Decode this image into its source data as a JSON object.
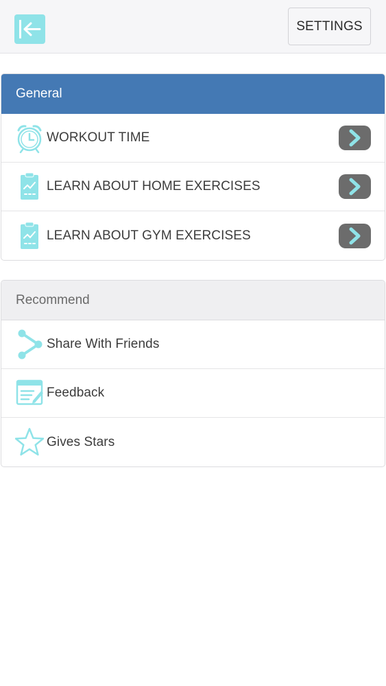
{
  "header": {
    "back_icon": "back-arrow-icon",
    "settings_label": "SETTINGS"
  },
  "general": {
    "title": "General",
    "items": [
      {
        "label": "WORKOUT TIME",
        "icon": "alarm-clock-icon"
      },
      {
        "label": "LEARN ABOUT HOME EXERCISES",
        "icon": "clipboard-chart-icon"
      },
      {
        "label": "LEARN ABOUT GYM EXERCISES",
        "icon": "clipboard-chart-icon"
      }
    ]
  },
  "recommend": {
    "title": "Recommend",
    "items": [
      {
        "label": "Share With Friends",
        "icon": "share-icon"
      },
      {
        "label": "Feedback",
        "icon": "feedback-edit-icon"
      },
      {
        "label": "Gives Stars",
        "icon": "star-icon"
      }
    ]
  },
  "colors": {
    "accent": "#8fe3e8",
    "general_header": "#4479b4",
    "recommend_header": "#efeff1",
    "chevron_bg": "#6c6c6c"
  }
}
